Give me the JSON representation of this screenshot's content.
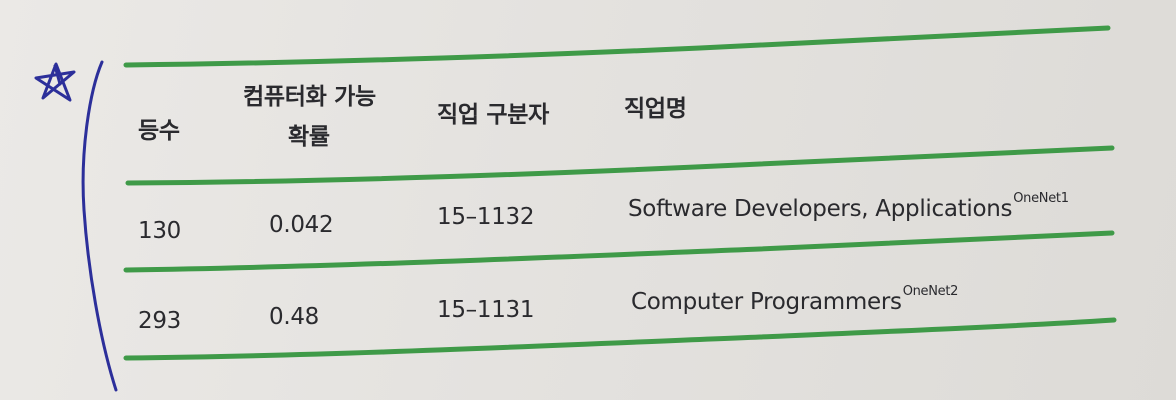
{
  "colors": {
    "rule_green": "#3f9a48",
    "pen_blue": "#2c2f9a",
    "paper": "#e6e4e0",
    "ink": "#2a2a2e"
  },
  "margin_mark": {
    "icon": "star-icon"
  },
  "table": {
    "headers": {
      "rank": "등수",
      "probability_line1": "컴퓨터화 가능",
      "probability_line2": "확률",
      "code": "직업 구분자",
      "occupation": "직업명"
    },
    "rows": [
      {
        "rank": "130",
        "probability": "0.042",
        "code": "15–1132",
        "occupation": "Software Developers, Applications",
        "note": "OneNet1"
      },
      {
        "rank": "293",
        "probability": "0.48",
        "code": "15–1131",
        "occupation": "Computer Programmers",
        "note": "OneNet2"
      }
    ]
  }
}
